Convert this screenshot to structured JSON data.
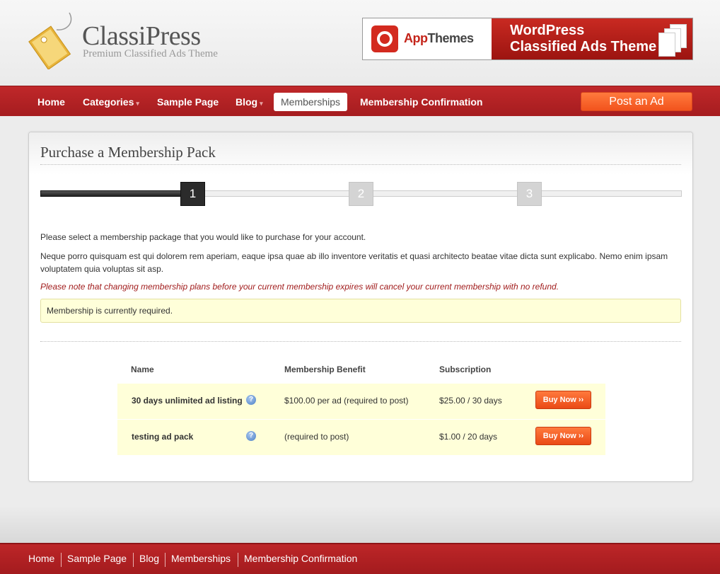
{
  "site": {
    "name": "ClassiPress",
    "tagline": "Premium Classified Ads Theme"
  },
  "banner": {
    "brand_prefix": "App",
    "brand_suffix": "Themes",
    "headline_line1": "WordPress",
    "headline_line2": "Classified Ads Theme"
  },
  "nav": {
    "items": [
      {
        "label": "Home"
      },
      {
        "label": "Categories",
        "caret": "▾"
      },
      {
        "label": "Sample Page"
      },
      {
        "label": "Blog",
        "caret": "▾"
      },
      {
        "label": "Memberships",
        "active": true
      },
      {
        "label": "Membership Confirmation"
      }
    ],
    "post_ad_label": "Post an Ad"
  },
  "page": {
    "title": "Purchase a Membership Pack",
    "steps": [
      "1",
      "2",
      "3"
    ],
    "current_step": 1,
    "intro": "Please select a membership package that you would like to purchase for your account.",
    "description": "Neque porro quisquam est qui dolorem rem aperiam, eaque ipsa quae ab illo inventore veritatis et quasi architecto beatae vitae dicta sunt explicabo. Nemo enim ipsam voluptatem quia voluptas sit asp.",
    "warning": "Please note that changing membership plans before your current membership expires will cancel your current membership with no refund.",
    "notice": "Membership is currently required."
  },
  "table": {
    "headers": {
      "name": "Name",
      "benefit": "Membership Benefit",
      "subscription": "Subscription"
    },
    "rows": [
      {
        "name": "30 days unlimited ad listing",
        "benefit": "$100.00 per ad (required to post)",
        "subscription": "$25.00 / 30 days",
        "button": "Buy Now ››"
      },
      {
        "name": "testing ad pack",
        "benefit": "(required to post)",
        "subscription": "$1.00 / 20 days",
        "button": "Buy Now ››"
      }
    ],
    "help_glyph": "?"
  },
  "footer": {
    "items": [
      "Home",
      "Sample Page",
      "Blog",
      "Memberships",
      "Membership Confirmation"
    ]
  },
  "colors": {
    "brand_red": "#b22226",
    "accent_orange": "#f2531d",
    "notice_bg": "#ffffd9",
    "warning_text": "#a11c1c"
  }
}
